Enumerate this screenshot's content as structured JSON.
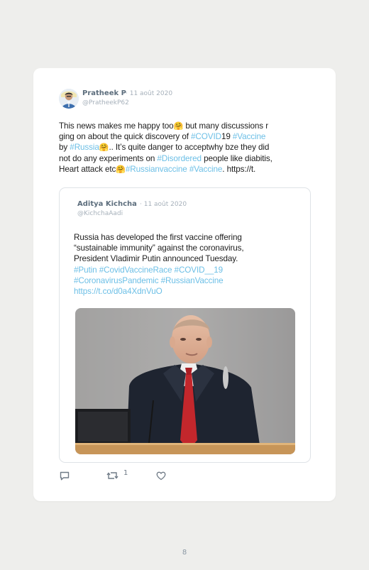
{
  "tweet": {
    "author_name": "Pratheek P",
    "date": "· 11 août 2020",
    "handle": "@PratheekP62",
    "lines": [
      [
        {
          "t": "This news makes me happy too"
        },
        {
          "e": "🤗"
        },
        {
          "t": " but many discussions r"
        }
      ],
      [
        {
          "t": "ging on about the quick discovery of "
        },
        {
          "h": "#COVID"
        },
        {
          "t": "19 "
        },
        {
          "h": "#Vaccine"
        }
      ],
      [
        {
          "t": "by "
        },
        {
          "h": "#Russia"
        },
        {
          "e": "🤗"
        },
        {
          "t": ".. It’s quite danger to acceptwhy bze they did"
        }
      ],
      [
        {
          "t": "not do any experiments on "
        },
        {
          "h": "#Disordered"
        },
        {
          "t": " people like diabitis,"
        }
      ],
      [
        {
          "t": "Heart attack etc"
        },
        {
          "e": "🤗"
        },
        {
          "h": "#Russianvaccine"
        },
        {
          "t": " "
        },
        {
          "h": "#Vaccine"
        },
        {
          "t": ". https://t."
        }
      ]
    ]
  },
  "quoted": {
    "author_name": "Aditya Kichcha",
    "date": "· 11 août 2020",
    "handle": "@KichchaAadi",
    "lines": [
      [
        {
          "t": "Russia has developed the first vaccine offering"
        }
      ],
      [
        {
          "t": "“sustainable immunity” against the coronavirus,"
        }
      ],
      [
        {
          "t": "President Vladimir Putin announced Tuesday."
        }
      ],
      [
        {
          "h": "#Putin"
        },
        {
          "t": " "
        },
        {
          "h": "#CovidVaccineRace"
        },
        {
          "t": " "
        },
        {
          "h": "#COVID__19"
        }
      ],
      [
        {
          "h": "#CoronavirusPandemic"
        },
        {
          "t": " "
        },
        {
          "h": "#RussianVaccine"
        }
      ],
      [
        {
          "h": "https://t.co/d0a4XdnVuO"
        }
      ]
    ]
  },
  "actions": {
    "reply_icon": "reply-icon",
    "retweet_icon": "retweet-icon",
    "retweet_count": "1",
    "like_icon": "heart-icon"
  },
  "colors": {
    "hashtag": "#6cbfe6",
    "name": "#5d6e7d",
    "meta": "#a7b1bb"
  },
  "page_number": "8"
}
